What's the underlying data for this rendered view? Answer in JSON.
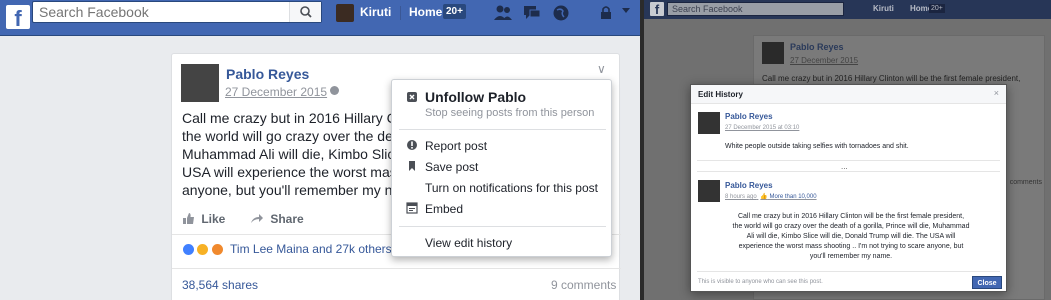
{
  "left": {
    "topbar": {
      "logo": "f",
      "search_placeholder": "Search Facebook",
      "user_name": "Kiruti",
      "home_label": "Home",
      "home_badge": "20+"
    },
    "post": {
      "author": "Pablo Reyes",
      "date": "27 December 2015",
      "text_lines": [
        "Call me crazy but in 2016 Hillary Clint",
        "the world will go crazy over the death",
        "Muhammad Ali will die, Kimbo Slice w",
        "USA will experience the worst mass s",
        "anyone, but you'll remember my name"
      ],
      "like_label": "Like",
      "share_label": "Share",
      "reactions_text": "Tim Lee Maina and 27k others",
      "shares_text": "38,564 shares",
      "comments_text": "9 comments"
    },
    "menu": {
      "unfollow_title": "Unfollow Pablo",
      "unfollow_subtitle": "Stop seeing posts from this person",
      "report": "Report post",
      "save": "Save post",
      "notifications": "Turn on notifications for this post",
      "embed": "Embed",
      "edit_history": "View edit history"
    }
  },
  "right": {
    "topbar": {
      "logo": "f",
      "search_placeholder": "Search Facebook",
      "user_name": "Kiruti",
      "home_label": "Home",
      "home_badge": "20+"
    },
    "background_post": {
      "author": "Pablo Reyes",
      "date": "27 December 2015",
      "text": "Call me crazy but in 2016 Hillary Clinton will be the first female president,",
      "comments": "comments"
    },
    "dialog": {
      "title": "Edit History",
      "close": "×",
      "entry1": {
        "author": "Pablo Reyes",
        "date": "27 December 2015 at 03:10",
        "text": "White people outside taking selfies with tornadoes and shit."
      },
      "ellipsis": "...",
      "entry2": {
        "author": "Pablo Reyes",
        "date": "8 hours ago",
        "audience": "More than 10,000",
        "text_lines": [
          "Call me crazy but in 2016 Hillary Clinton will be the first female president,",
          "the world will go crazy over the death of a gorilla, Prince will die, Muhammad",
          "Ali will die, Kimbo Slice will die, Donald Trump will die. The USA will",
          "experience the worst mass shooting .. I'm not trying to scare anyone, but",
          "you'll remember my name."
        ]
      },
      "footer": "This is visible to anyone who can see this post.",
      "close_button": "Close"
    }
  }
}
